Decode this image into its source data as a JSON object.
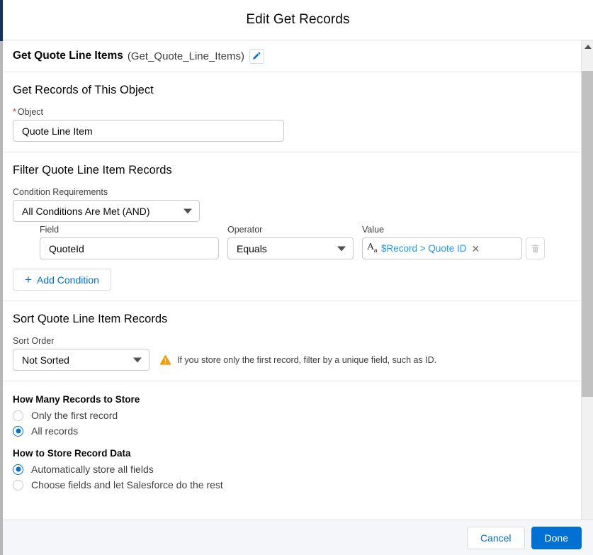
{
  "modal": {
    "title": "Edit Get Records"
  },
  "element": {
    "label": "Get Quote Line Items",
    "api_name": "(Get_Quote_Line_Items)",
    "edit_icon": "pencil-icon"
  },
  "object_section": {
    "title": "Get Records of This Object",
    "field_label": "Object",
    "required_marker": "*",
    "value": "Quote Line Item"
  },
  "filter_section": {
    "title": "Filter Quote Line Item Records",
    "condition_requirements_label": "Condition Requirements",
    "condition_requirements_value": "All Conditions Are Met (AND)",
    "columns": {
      "field": "Field",
      "operator": "Operator",
      "value": "Value"
    },
    "conditions": [
      {
        "field": "QuoteId",
        "operator": "Equals",
        "value_icon": "text-type-icon",
        "value_icon_glyph": "Aa",
        "value_token": "$Record > Quote ID",
        "token_remove": "✕",
        "delete_icon": "trash-icon"
      }
    ],
    "add_condition_label": "Add Condition",
    "add_condition_icon": "plus-icon"
  },
  "sort_section": {
    "title": "Sort Quote Line Item Records",
    "sort_order_label": "Sort Order",
    "sort_order_value": "Not Sorted",
    "warning_icon": "warning-triangle-icon",
    "warning_text": "If you store only the first record, filter by a unique field, such as ID."
  },
  "store_section": {
    "how_many_title": "How Many Records to Store",
    "how_many_options": [
      {
        "label": "Only the first record",
        "selected": false
      },
      {
        "label": "All records",
        "selected": true
      }
    ],
    "how_to_store_title": "How to Store Record Data",
    "how_to_store_options": [
      {
        "label": "Automatically store all fields",
        "selected": true
      },
      {
        "label": "Choose fields and let Salesforce do the rest",
        "selected": false
      }
    ]
  },
  "scrollbar": {
    "up_icon": "scroll-up-arrow-icon"
  },
  "footer": {
    "cancel_label": "Cancel",
    "done_label": "Done"
  },
  "colors": {
    "accent_blue": "#0070d2",
    "token_blue": "#1b96ff",
    "warning_orange": "#f59b00",
    "required_red": "#c23934",
    "header_navy": "#16325c"
  }
}
